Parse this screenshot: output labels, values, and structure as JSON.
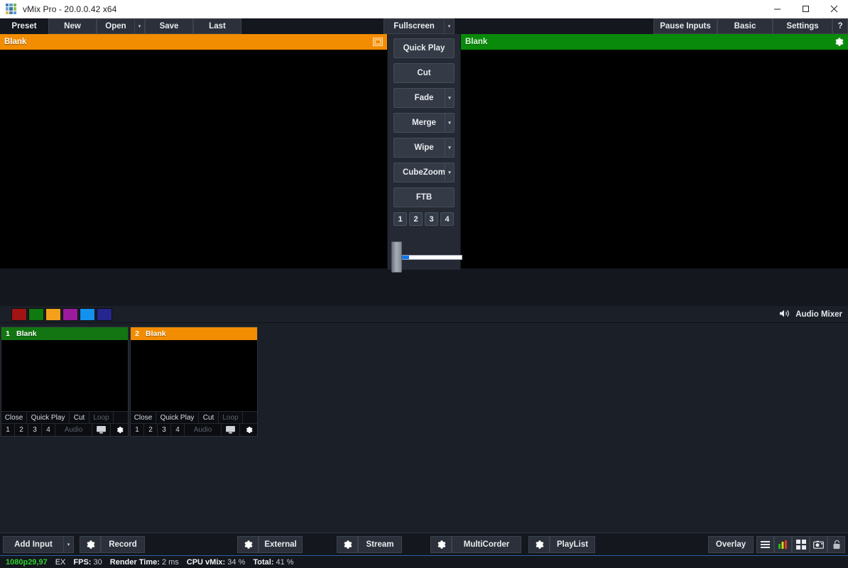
{
  "window": {
    "title": "vMix Pro - 20.0.0.42 x64",
    "logo_colors": [
      "#4a7fb5",
      "#5b9bd5",
      "#7ab648",
      "#6fa8dc",
      "#3f6fa8",
      "#8cc152",
      "#e8b84b",
      "#4a7fb5",
      "#5b9bd5"
    ],
    "minimize": "—",
    "maximize": "☐",
    "close": "✕"
  },
  "toolbar": {
    "preset_label": "Preset",
    "new_label": "New",
    "open_label": "Open",
    "open_arrow": "▾",
    "save_label": "Save",
    "last_label": "Last",
    "fullscreen_label": "Fullscreen",
    "fullscreen_arrow": "▾",
    "pause_inputs_label": "Pause Inputs",
    "basic_label": "Basic",
    "settings_label": "Settings",
    "help_label": "?"
  },
  "preview": {
    "title": "Blank",
    "header_color": "#f28c00",
    "icon": "multiview-icon"
  },
  "program": {
    "title": "Blank",
    "header_color": "#0a8a0a",
    "icon": "gear-icon"
  },
  "transitions": {
    "quick_play": "Quick Play",
    "cut": "Cut",
    "fade": "Fade",
    "merge": "Merge",
    "wipe": "Wipe",
    "cubezoom": "CubeZoom",
    "ftb": "FTB",
    "arrow": "▾",
    "numbers": [
      "1",
      "2",
      "3",
      "4"
    ],
    "tbar_value": 0
  },
  "mid_strip": {
    "swatch_colors": [
      "#a01414",
      "#0f7a10",
      "#f4a01a",
      "#9c1b9c",
      "#1490ee",
      "#26268f"
    ],
    "audio_mixer_label": "Audio Mixer",
    "speaker_icon": "speaker-icon"
  },
  "inputs": [
    {
      "number": "1",
      "title": "Blank",
      "state": "program",
      "header_color": "#127512",
      "close": "Close",
      "quick_play": "Quick Play",
      "cut": "Cut",
      "loop": "Loop",
      "loop_enabled": false,
      "numbers": [
        "1",
        "2",
        "3",
        "4"
      ],
      "audio": "Audio",
      "audio_enabled": false,
      "monitor_icon": "monitor-icon",
      "gear_icon": "gear-icon"
    },
    {
      "number": "2",
      "title": "Blank",
      "state": "preview",
      "header_color": "#f28c00",
      "close": "Close",
      "quick_play": "Quick Play",
      "cut": "Cut",
      "loop": "Loop",
      "loop_enabled": false,
      "numbers": [
        "1",
        "2",
        "3",
        "4"
      ],
      "audio": "Audio",
      "audio_enabled": false,
      "monitor_icon": "monitor-icon",
      "gear_icon": "gear-icon"
    }
  ],
  "bottombar": {
    "add_input_label": "Add Input",
    "add_input_arrow": "▾",
    "record_label": "Record",
    "external_label": "External",
    "stream_label": "Stream",
    "multicorder_label": "MultiCorder",
    "playlist_label": "PlayList",
    "overlay_label": "Overlay",
    "gear_icon": "gear-icon",
    "icons": [
      "hamburger-menu-icon",
      "audio-meter-icon",
      "multiview-grid-icon",
      "snapshot-icon",
      "lock-icon"
    ]
  },
  "statusbar": {
    "resolution": "1080p29,97",
    "ex_label": "EX",
    "fps_label": "FPS:",
    "fps_value": "30",
    "render_label": "Render Time:",
    "render_value": "2 ms",
    "cpu_label": "CPU vMix:",
    "cpu_value": "34 %",
    "total_label": "Total:",
    "total_value": "41 %"
  }
}
